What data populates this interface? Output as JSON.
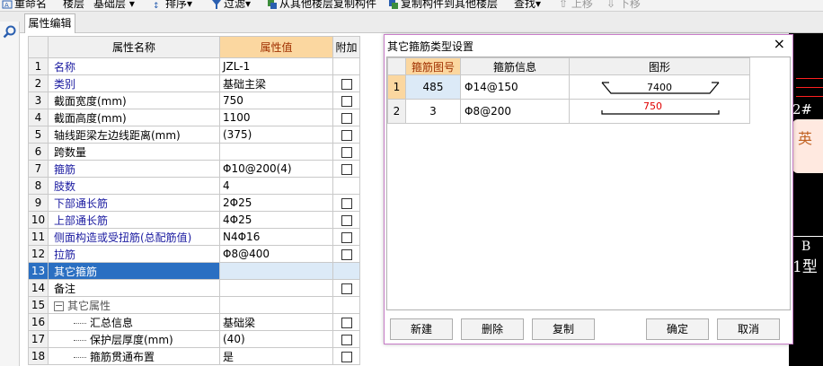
{
  "toolbar": {
    "items": [
      "重命名",
      "楼层",
      "基础层",
      "排序",
      "过滤",
      "从其他楼层复制构件",
      "复制构件到其他楼层",
      "查找",
      "上移",
      "下移"
    ]
  },
  "tab": {
    "label": "属性编辑"
  },
  "grid": {
    "headers": {
      "name": "属性名称",
      "value": "属性值",
      "extra": "附加"
    },
    "rows": [
      {
        "n": "1",
        "name": "名称",
        "value": "JZL-1",
        "blue": true,
        "check": false
      },
      {
        "n": "2",
        "name": "类别",
        "value": "基础主梁",
        "blue": true,
        "check": true
      },
      {
        "n": "3",
        "name": "截面宽度(mm)",
        "value": "750",
        "blue": false,
        "check": true
      },
      {
        "n": "4",
        "name": "截面高度(mm)",
        "value": "1100",
        "blue": false,
        "check": true
      },
      {
        "n": "5",
        "name": "轴线距梁左边线距离(mm)",
        "value": "(375)",
        "blue": false,
        "check": true
      },
      {
        "n": "6",
        "name": "跨数量",
        "value": "",
        "blue": false,
        "check": true
      },
      {
        "n": "7",
        "name": "箍筋",
        "value": "Φ10@200(4)",
        "blue": true,
        "check": true
      },
      {
        "n": "8",
        "name": "肢数",
        "value": "4",
        "blue": true,
        "check": false
      },
      {
        "n": "9",
        "name": "下部通长筋",
        "value": "2Φ25",
        "blue": true,
        "check": true
      },
      {
        "n": "10",
        "name": "上部通长筋",
        "value": "4Φ25",
        "blue": true,
        "check": true
      },
      {
        "n": "11",
        "name": "侧面构造或受扭筋(总配筋值)",
        "value": "N4Φ16",
        "blue": true,
        "check": true
      },
      {
        "n": "12",
        "name": "拉筋",
        "value": "Φ8@400",
        "blue": true,
        "check": true
      },
      {
        "n": "13",
        "name": "其它箍筋",
        "value": "",
        "blue": false,
        "check": false,
        "selected": true
      },
      {
        "n": "14",
        "name": "备注",
        "value": "",
        "blue": false,
        "check": true
      },
      {
        "n": "15",
        "name": "其它属性",
        "value": "",
        "group": true,
        "expander": "−"
      },
      {
        "n": "16",
        "name": "汇总信息",
        "value": "基础梁",
        "child": true,
        "check": true
      },
      {
        "n": "17",
        "name": "保护层厚度(mm)",
        "value": "(40)",
        "child": true,
        "check": true
      },
      {
        "n": "18",
        "name": "箍筋贯通布置",
        "value": "是",
        "child": true,
        "check": true
      }
    ]
  },
  "cad": {
    "label_top": "2#",
    "label_mid": "B",
    "label_bot": "1型",
    "badge": "英"
  },
  "dialog": {
    "title": "其它箍筋类型设置",
    "close": "×",
    "headers": {
      "code": "箍筋图号",
      "info": "箍筋信息",
      "shape": "图形"
    },
    "rows": [
      {
        "n": "1",
        "code": "485",
        "info": "Φ14@150",
        "shape_label": "7400"
      },
      {
        "n": "2",
        "code": "3",
        "info": "Φ8@200",
        "shape_label": "750"
      }
    ],
    "buttons": {
      "new": "新建",
      "delete": "删除",
      "copy": "复制",
      "ok": "确定",
      "cancel": "取消"
    }
  },
  "colors": {
    "selected_row": "#2a6fc2",
    "header_highlight": "#fbd7a0",
    "label_blue": "#1a1aa0",
    "dialog_border": "#c77cc7"
  }
}
